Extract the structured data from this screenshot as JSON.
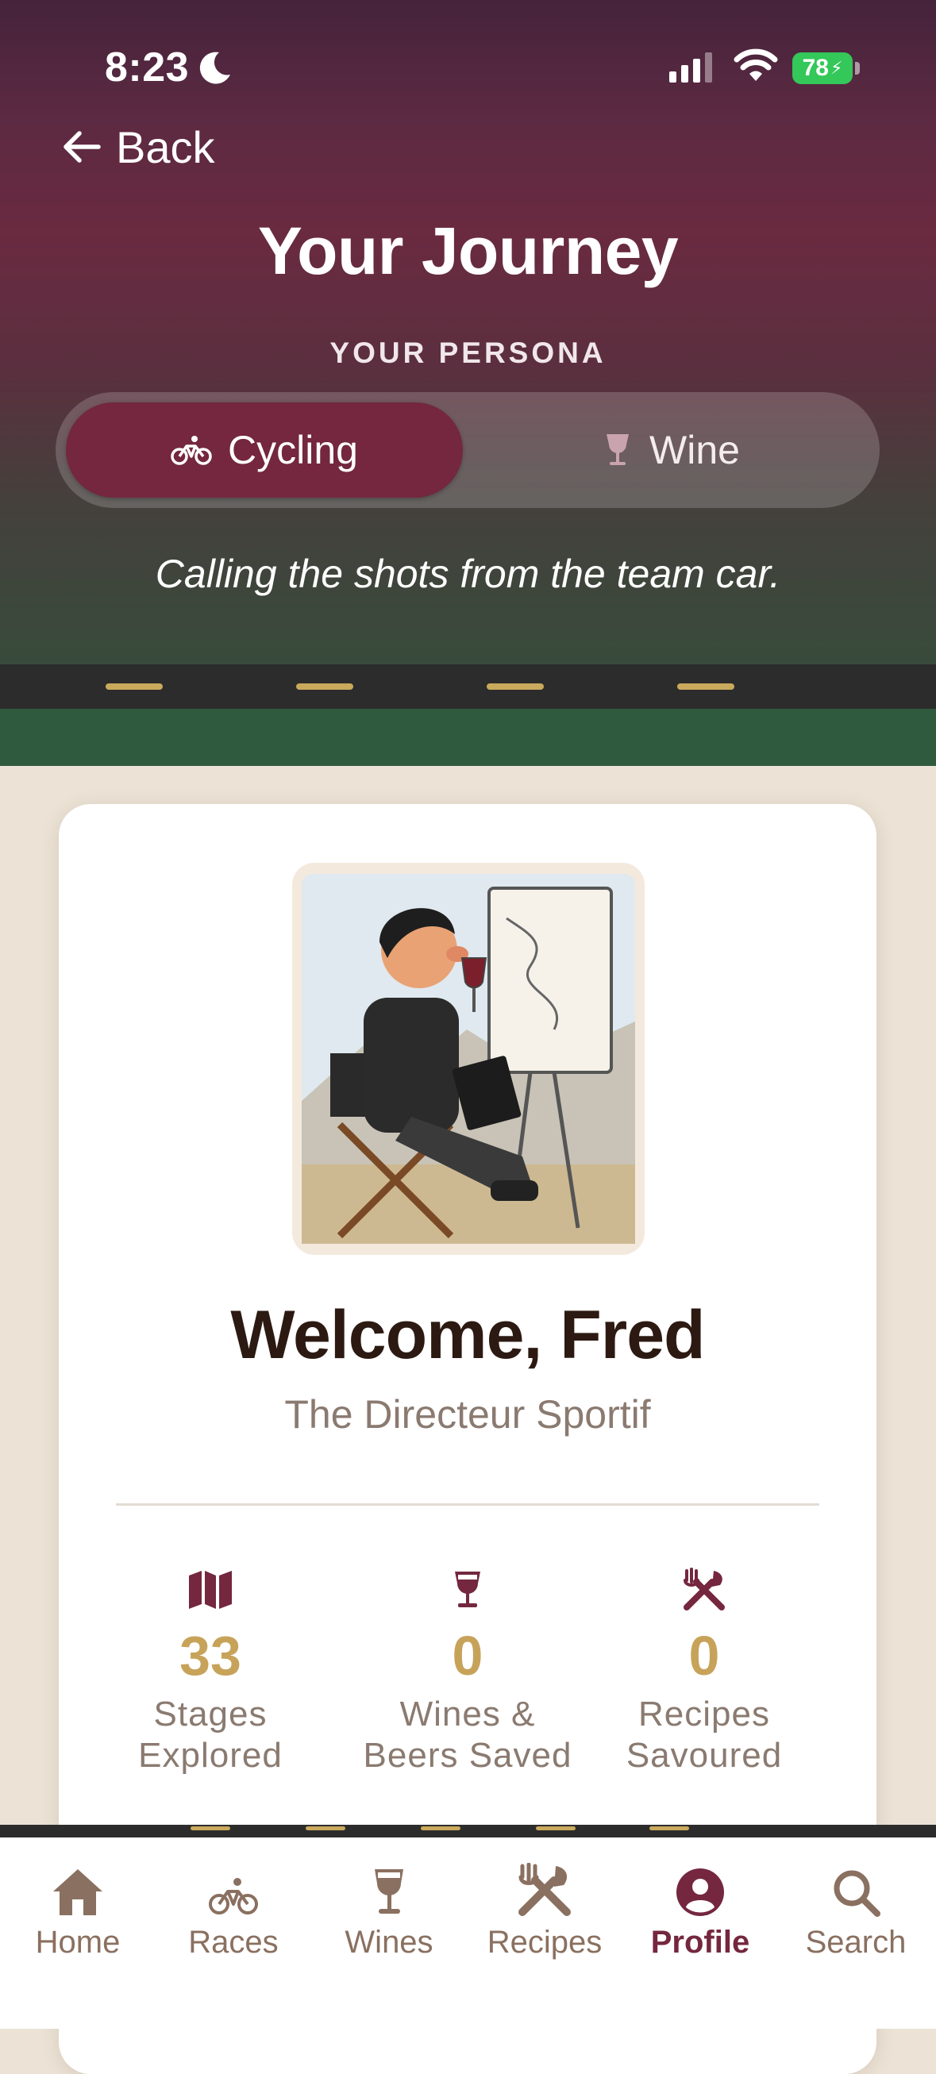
{
  "status": {
    "time": "8:23",
    "battery": "78"
  },
  "nav": {
    "back_label": "Back"
  },
  "header": {
    "title": "Your Journey",
    "persona_label": "YOUR PERSONA",
    "personas": [
      {
        "label": "Cycling",
        "icon": "bicycle-icon",
        "active": true
      },
      {
        "label": "Wine",
        "icon": "wine-glass-icon",
        "active": false
      }
    ],
    "tagline": "Calling the shots from the team car."
  },
  "profile": {
    "welcome": "Welcome, Fred",
    "persona_title": "The Directeur Sportif",
    "stats": [
      {
        "icon": "map-icon",
        "value": "33",
        "label": "Stages Explored"
      },
      {
        "icon": "wine-glass-icon",
        "value": "0",
        "label": "Wines & Beers Saved"
      },
      {
        "icon": "utensils-icon",
        "value": "0",
        "label": "Recipes Savoured"
      }
    ]
  },
  "tabbar": {
    "tabs": [
      {
        "label": "Home",
        "icon": "home-icon"
      },
      {
        "label": "Races",
        "icon": "bicycle-icon"
      },
      {
        "label": "Wines",
        "icon": "wine-glass-icon"
      },
      {
        "label": "Recipes",
        "icon": "utensils-icon"
      },
      {
        "label": "Profile",
        "icon": "user-circle-icon",
        "active": true
      },
      {
        "label": "Search",
        "icon": "search-icon"
      }
    ]
  },
  "colors": {
    "accent": "#74273f",
    "gold": "#c7a35a",
    "grass": "#2f5a3e"
  }
}
